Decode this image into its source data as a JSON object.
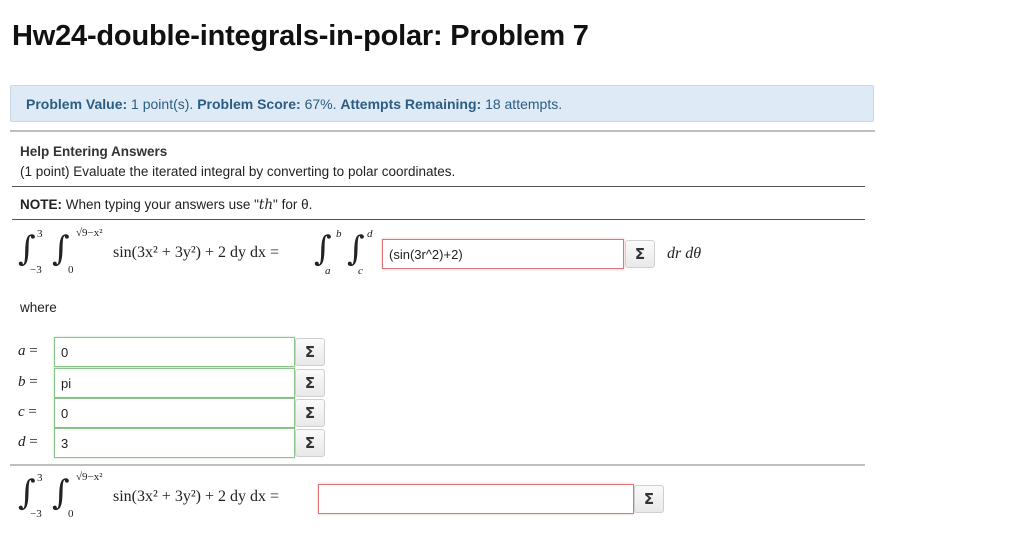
{
  "page": {
    "title": "Hw24-double-integrals-in-polar: Problem 7"
  },
  "score_bar": {
    "problem_value_label": "Problem Value:",
    "problem_value": "1 point(s).",
    "problem_score_label": "Problem Score:",
    "problem_score": "67%.",
    "attempts_label": "Attempts Remaining:",
    "attempts": "18 attempts."
  },
  "help": {
    "link_label": "Help Entering Answers",
    "instruction": "(1 point) Evaluate the iterated integral by converting to polar coordinates."
  },
  "note": {
    "label": "NOTE:",
    "text_before": "When typing your answers use \"",
    "code": "th",
    "text_after": "\" for θ."
  },
  "integral": {
    "upper_x": "3",
    "lower_x": "−3",
    "upper_y": "√9−x²",
    "lower_y": "0",
    "integrand": "sin(3x² + 3y²) + 2 dy dx =",
    "polar_upper_outer": "b",
    "polar_lower_outer": "a",
    "polar_upper_inner": "d",
    "polar_lower_inner": "c",
    "polar_integrand_value": "(sin(3r^2)+2)",
    "polar_differentials": "dr dθ"
  },
  "where_label": "where",
  "bounds": [
    {
      "var": "a",
      "eq": "=",
      "value": "0"
    },
    {
      "var": "b",
      "eq": "=",
      "value": "pi"
    },
    {
      "var": "c",
      "eq": "=",
      "value": "0"
    },
    {
      "var": "d",
      "eq": "=",
      "value": "3"
    }
  ],
  "final_answer": {
    "value": ""
  },
  "buttons": {
    "sigma": "Σ"
  },
  "colors": {
    "score_bar_bg": "#deeaf5",
    "score_bar_text": "#2c5d83",
    "correct_border": "#8bc58b",
    "incorrect_border": "#dd7777"
  }
}
